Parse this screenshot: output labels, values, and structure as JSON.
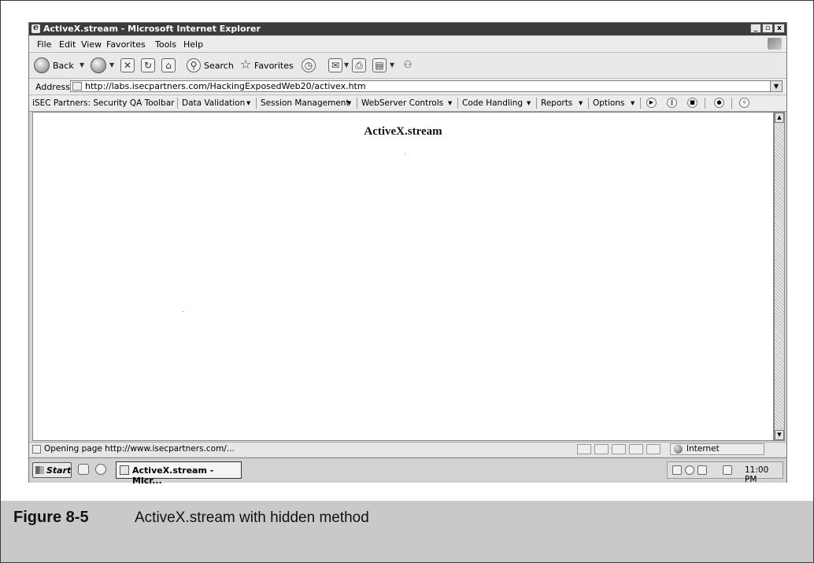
{
  "window": {
    "title": "ActiveX.stream - Microsoft Internet Explorer",
    "controls": [
      "_",
      "▫",
      "x"
    ]
  },
  "menu": [
    "File",
    "Edit",
    "View",
    "Favorites",
    "Tools",
    "Help"
  ],
  "toolbar": {
    "back_label": "Back",
    "search_label": "Search",
    "favorites_label": "Favorites"
  },
  "address": {
    "label": "Address",
    "url": "http://labs.isecpartners.com/HackingExposedWeb20/activex.htm"
  },
  "isec_toolbar": {
    "title": "iSEC Partners: Security QA Toolbar",
    "menus": [
      "Data Validation",
      "Session Management",
      "WebServer Controls",
      "Code Handling",
      "Reports",
      "Options"
    ]
  },
  "page": {
    "heading": "ActiveX.stream"
  },
  "status": {
    "text": "Opening page http://www.isecpartners.com/...",
    "zone": "Internet"
  },
  "taskbar": {
    "start_label": "Start",
    "task_label": "ActiveX.stream - Micr...",
    "clock": "11:00 PM"
  },
  "caption": {
    "figure": "Figure 8-5",
    "text": "ActiveX.stream with hidden method"
  }
}
